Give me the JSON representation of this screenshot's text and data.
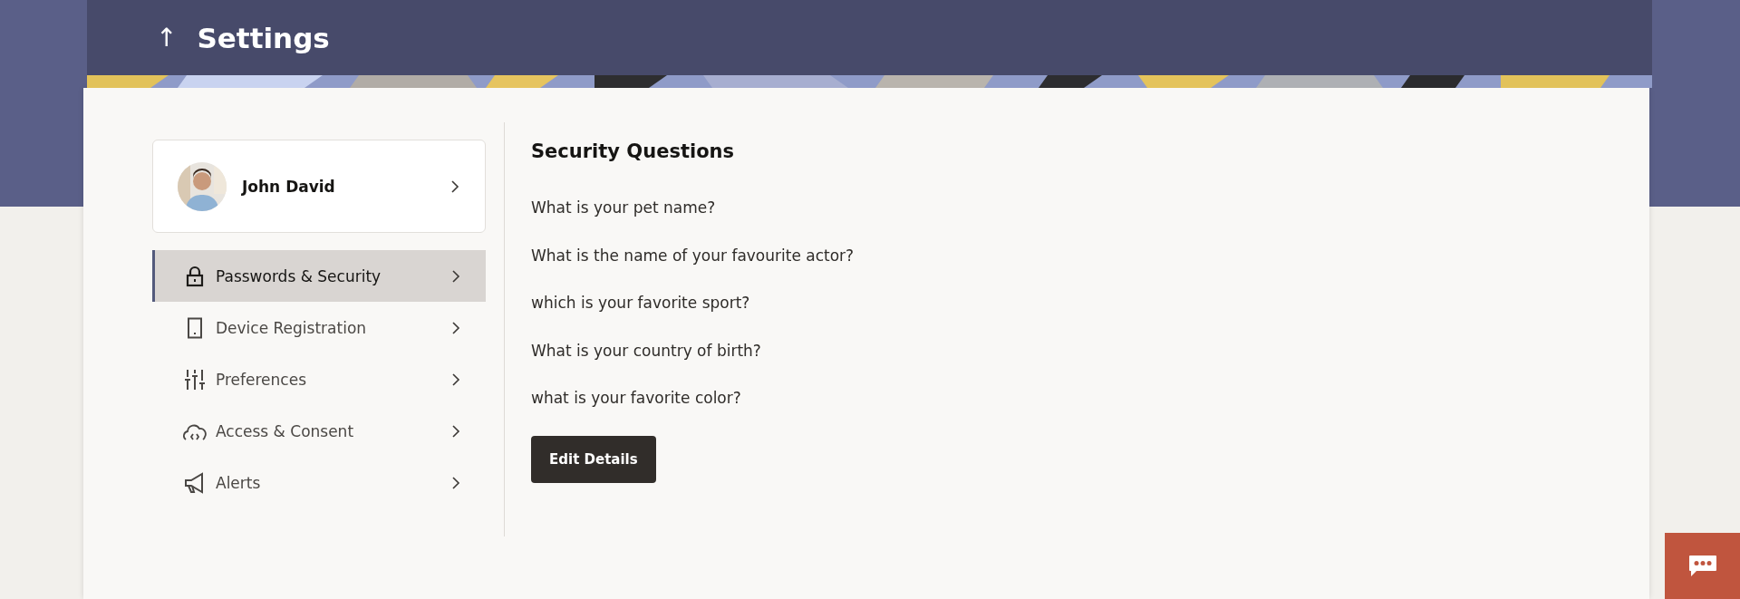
{
  "header": {
    "back": "↑",
    "title": "Settings"
  },
  "profile": {
    "name": "John David"
  },
  "menu": [
    {
      "label": "Passwords & Security",
      "selected": true
    },
    {
      "label": "Device Registration",
      "selected": false
    },
    {
      "label": "Preferences",
      "selected": false
    },
    {
      "label": "Access & Consent",
      "selected": false
    },
    {
      "label": "Alerts",
      "selected": false
    }
  ],
  "panel": {
    "title": "Security Questions",
    "questions": [
      "What is your pet name?",
      "What is the name of your favourite actor?",
      "which is your favorite sport?",
      "What is your country of birth?",
      "what is your favorite color?"
    ],
    "button": "Edit Details"
  }
}
